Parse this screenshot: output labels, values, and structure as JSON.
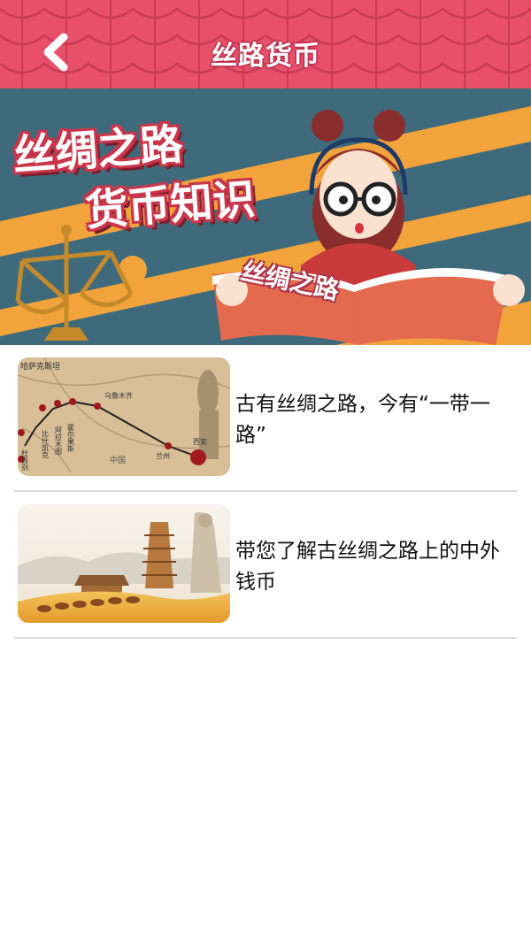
{
  "header": {
    "title": "丝路货币",
    "back_icon": "chevron-left-icon"
  },
  "banner": {
    "line1": "丝绸之路",
    "line2": "货币知识",
    "book_title": "丝绸之路"
  },
  "articles": [
    {
      "title": "古有丝绸之路，今有“一带一路”",
      "map_labels": [
        "哈萨克斯坦",
        "乌鲁木齐",
        "霍尔果斯",
        "阿拉木图",
        "比什凯克",
        "杜尚别",
        "中国",
        "兰州",
        "西安"
      ]
    },
    {
      "title": "带您了解古丝绸之路上的中外钱币"
    }
  ],
  "colors": {
    "header": "#e8506a",
    "banner_bg": "#3e6a7c",
    "stripe": "#f3a33b"
  }
}
